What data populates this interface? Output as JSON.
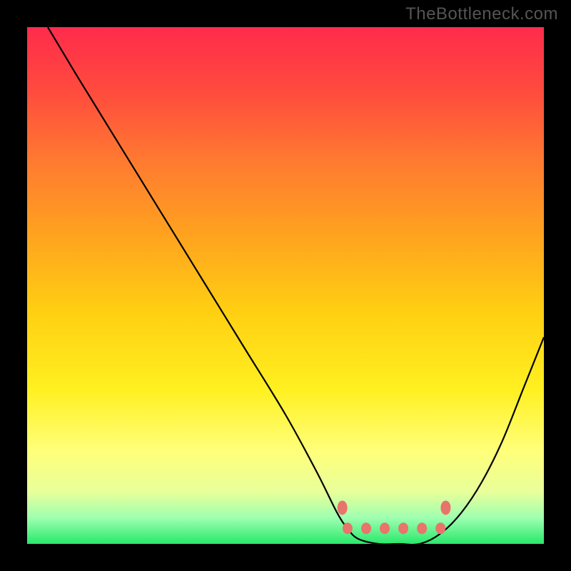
{
  "watermark": "TheBottleneck.com",
  "chart_data": {
    "type": "line",
    "title": "",
    "xlabel": "",
    "ylabel": "",
    "xlim": [
      0,
      100
    ],
    "ylim": [
      0,
      100
    ],
    "grid": false,
    "series": [
      {
        "name": "bottleneck-curve",
        "x": [
          4,
          10,
          18,
          26,
          34,
          42,
          50,
          56,
          60,
          62,
          64,
          68,
          72,
          76,
          80,
          84,
          88,
          92,
          96,
          100
        ],
        "values": [
          100,
          90,
          77,
          64,
          51,
          38,
          25,
          14,
          6,
          3,
          1,
          0,
          0,
          0,
          2,
          6,
          12,
          20,
          30,
          40
        ]
      }
    ],
    "flat_zone": {
      "x_start": 62,
      "x_end": 80,
      "y": 3
    },
    "marker_color": "#e8746c",
    "curve_color": "#000000",
    "background_gradient": [
      {
        "stop": 0,
        "color": "#ff2b4c"
      },
      {
        "stop": 25,
        "color": "#ff7a30"
      },
      {
        "stop": 55,
        "color": "#ffcf12"
      },
      {
        "stop": 80,
        "color": "#ffff7a"
      },
      {
        "stop": 100,
        "color": "#29e86b"
      }
    ]
  }
}
